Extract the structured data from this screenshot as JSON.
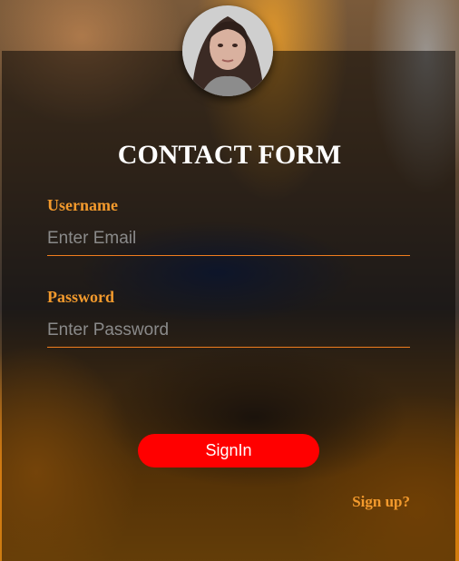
{
  "form": {
    "title": "CONTACT FORM",
    "username_label": "Username",
    "username_placeholder": "Enter Email",
    "password_label": "Password",
    "password_placeholder": "Enter Password",
    "signin_label": "SignIn",
    "signup_label": "Sign up?"
  },
  "colors": {
    "accent": "#f39a2d",
    "underline": "#f07d1e",
    "button": "#ff0000"
  },
  "icons": {
    "avatar": "user-photo"
  }
}
